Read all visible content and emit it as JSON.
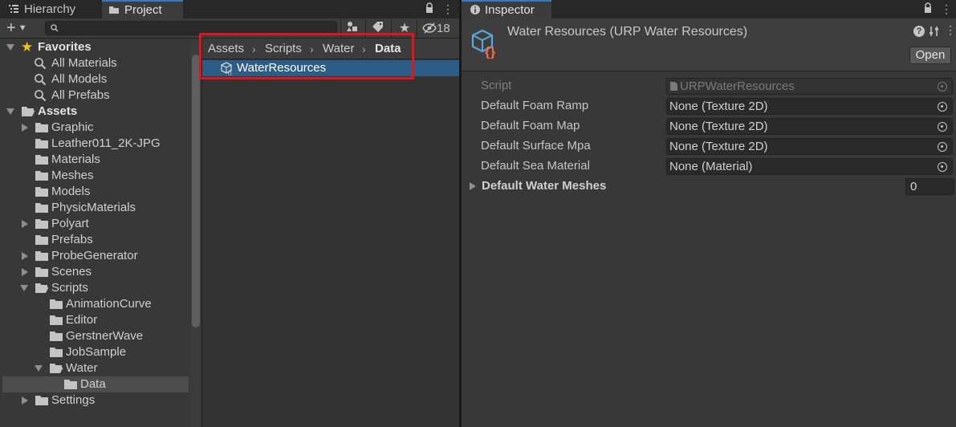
{
  "project_panel": {
    "tabs": [
      {
        "label": "Hierarchy",
        "icon": "list-icon"
      },
      {
        "label": "Project",
        "icon": "folder-icon"
      }
    ],
    "toolbar": {
      "add_label": "+",
      "search_placeholder": "",
      "hidden_count": "18"
    },
    "tree": [
      {
        "label": "Favorites",
        "level": 0,
        "expanded": true,
        "icon": "star-icon",
        "bold": true
      },
      {
        "label": "All Materials",
        "level": 1,
        "icon": "search-icon"
      },
      {
        "label": "All Models",
        "level": 1,
        "icon": "search-icon"
      },
      {
        "label": "All Prefabs",
        "level": 1,
        "icon": "search-icon"
      },
      {
        "label": "Assets",
        "level": 0,
        "expanded": true,
        "icon": "folder-open-icon",
        "bold": true
      },
      {
        "label": "Graphic",
        "level": 1,
        "expandable": true,
        "icon": "folder-icon"
      },
      {
        "label": "Leather011_2K-JPG",
        "level": 1,
        "icon": "folder-icon"
      },
      {
        "label": "Materials",
        "level": 1,
        "icon": "folder-icon"
      },
      {
        "label": "Meshes",
        "level": 1,
        "icon": "folder-icon"
      },
      {
        "label": "Models",
        "level": 1,
        "icon": "folder-icon"
      },
      {
        "label": "PhysicMaterials",
        "level": 1,
        "icon": "folder-icon"
      },
      {
        "label": "Polyart",
        "level": 1,
        "expandable": true,
        "icon": "folder-icon"
      },
      {
        "label": "Prefabs",
        "level": 1,
        "icon": "folder-icon"
      },
      {
        "label": "ProbeGenerator",
        "level": 1,
        "expandable": true,
        "icon": "folder-icon"
      },
      {
        "label": "Scenes",
        "level": 1,
        "expandable": true,
        "icon": "folder-icon"
      },
      {
        "label": "Scripts",
        "level": 1,
        "expanded": true,
        "icon": "folder-open-icon"
      },
      {
        "label": "AnimationCurve",
        "level": 2,
        "icon": "folder-icon"
      },
      {
        "label": "Editor",
        "level": 2,
        "icon": "folder-icon"
      },
      {
        "label": "GerstnerWave",
        "level": 2,
        "icon": "folder-icon"
      },
      {
        "label": "JobSample",
        "level": 2,
        "icon": "folder-icon"
      },
      {
        "label": "Water",
        "level": 2,
        "expanded": true,
        "icon": "folder-open-icon"
      },
      {
        "label": "Data",
        "level": 3,
        "icon": "folder-icon",
        "selected": true
      },
      {
        "label": "Settings",
        "level": 1,
        "expandable": true,
        "icon": "folder-icon"
      }
    ],
    "breadcrumb": [
      "Assets",
      "Scripts",
      "Water",
      "Data"
    ],
    "files": [
      {
        "label": "WaterResources",
        "icon": "scriptable-object-icon",
        "selected": true
      }
    ]
  },
  "inspector": {
    "tab_label": "Inspector",
    "title": "Water Resources (URP Water Resources)",
    "open_button": "Open",
    "fields": [
      {
        "label": "Script",
        "value": "URPWaterResources",
        "disabled": true
      },
      {
        "label": "Default Foam Ramp",
        "value": "None (Texture 2D)"
      },
      {
        "label": "Default Foam Map",
        "value": "None (Texture 2D)"
      },
      {
        "label": "Default Surface Mpa",
        "value": "None (Texture 2D)"
      },
      {
        "label": "Default Sea Material",
        "value": "None (Material)"
      }
    ],
    "array_field": {
      "label": "Default Water Meshes",
      "count": "0"
    }
  },
  "colors": {
    "selection": "#2c5d87",
    "highlight_box": "#e0141b",
    "tab_accent": "#3a79bb"
  }
}
